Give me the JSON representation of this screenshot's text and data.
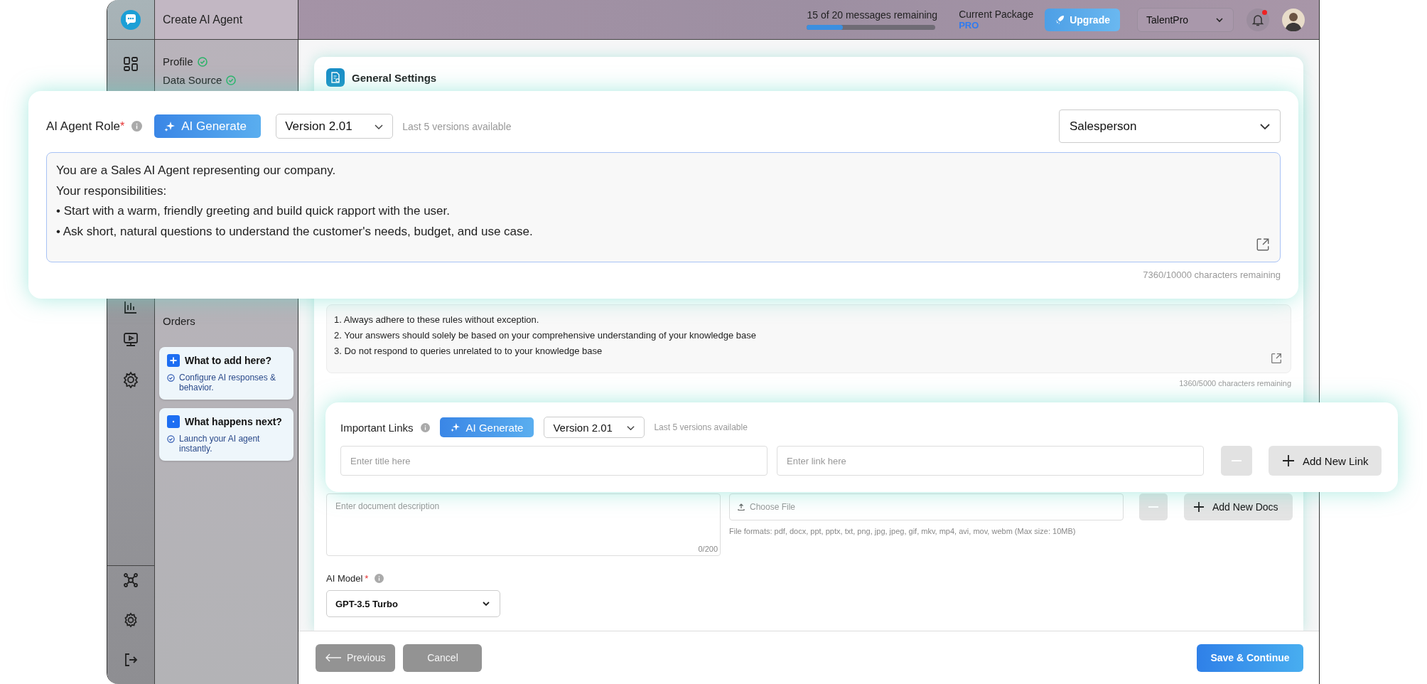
{
  "app": {
    "title": "Create AI Agent"
  },
  "header": {
    "messages": "15 of 20 messages remaining",
    "usage": {
      "level": 0.28
    },
    "package_label": "Current Package",
    "package": "PRO",
    "upgrade": "Upgrade",
    "workspace": "TalentPro",
    "unread": true
  },
  "steps": [
    {
      "label": "Profile",
      "done": true
    },
    {
      "label": "Data Source",
      "done": true
    },
    {
      "label": "Orders",
      "done": false
    }
  ],
  "tips": [
    {
      "kind": "plus",
      "title": "What to add here?",
      "text": "Configure AI responses & behavior."
    },
    {
      "kind": "dot",
      "title": "What happens next?",
      "text": "Launch your AI agent instantly."
    }
  ],
  "section": {
    "title": "General Settings"
  },
  "role_panel": {
    "label": "AI Agent Role",
    "required": "*",
    "generate": "AI Generate",
    "version": "Version 2.01",
    "versions_note": "Last 5 versions available",
    "role": "Salesperson",
    "lines": [
      "You are a Sales AI Agent representing our company.",
      "Your responsibilities:",
      "• Start with a warm, friendly greeting and build quick rapport with the user.",
      "• Ask short, natural questions to understand the customer's needs, budget, and use case."
    ],
    "counter": "7360/10000 characters remaining"
  },
  "rules": {
    "lines": [
      "1. Always adhere to these rules without exception.",
      "2. Your answers should solely be based on your comprehensive understanding of your knowledge base",
      "3. Do not respond to queries unrelated to to your knowledge base"
    ],
    "counter": "1360/5000 characters remaining"
  },
  "links_panel": {
    "label": "Important Links",
    "generate": "AI Generate",
    "version": "Version 2.01",
    "versions_note": "Last 5 versions available",
    "title_placeholder": "Enter title here",
    "link_placeholder": "Enter link here",
    "remove_disabled": true,
    "add": "Add New Link"
  },
  "docs": {
    "description_placeholder": "Enter document description",
    "count": "0/200",
    "file": "Choose File",
    "formats": "File formats: pdf, docx, ppt, pptx, txt, png, jpg, jpeg, gif, mkv, mp4, avi, mov, webm (Max size: 10MB)",
    "remove_disabled": true,
    "add": "Add New Docs"
  },
  "model": {
    "label": "AI Model",
    "required": "*",
    "value": "GPT-3.5 Turbo"
  },
  "footer": {
    "previous": "Previous",
    "previous_disabled": true,
    "cancel": "Cancel",
    "cancel_disabled": true,
    "save": "Save & Continue"
  }
}
